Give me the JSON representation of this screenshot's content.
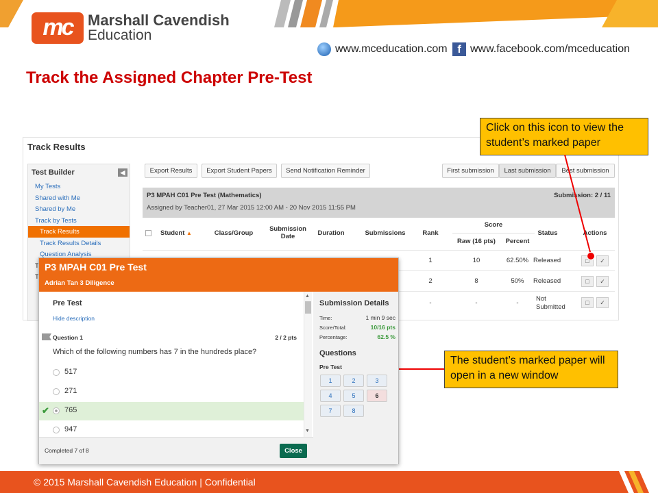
{
  "brand": {
    "logo_mark": "mc",
    "name_line1": "Marshall Cavendish",
    "name_line2": "Education",
    "website": "www.mceducation.com",
    "facebook": "www.facebook.com/mceducation",
    "accent": "#e8531e"
  },
  "slide_title": "Track the Assigned Chapter Pre-Test",
  "track_results": {
    "title": "Track Results",
    "sidebar": {
      "heading": "Test Builder",
      "items": [
        {
          "label": "My Tests"
        },
        {
          "label": "Shared with Me"
        },
        {
          "label": "Shared by Me"
        },
        {
          "label": "Track by Tests"
        },
        {
          "label": "Track Results",
          "active": true
        },
        {
          "label": "Track Results Details"
        },
        {
          "label": "Question Analysis"
        },
        {
          "label": "T"
        },
        {
          "label": "T"
        }
      ]
    },
    "toolbar": {
      "export_results": "Export Results",
      "export_papers": "Export Student Papers",
      "send_reminder": "Send Notification Reminder",
      "first_submission": "First submission",
      "last_submission": "Last submission",
      "best_submission": "Best submission"
    },
    "test_info": {
      "title": "P3 MPAH C01 Pre Test (Mathematics)",
      "assigned": "Assigned by Teacher01, 27 Mar 2015 12:00 AM - 20 Nov 2015 11:55 PM",
      "submission_label": "Submission: 2 / 11"
    },
    "columns": {
      "student": "Student",
      "class_group": "Class/Group",
      "submission_date": "Submission Date",
      "duration": "Duration",
      "submissions": "Submissions",
      "rank": "Rank",
      "score": "Score",
      "raw": "Raw (16 pts)",
      "percent": "Percent",
      "status": "Status",
      "actions": "Actions"
    },
    "rows": [
      {
        "rank": "1",
        "raw": "10",
        "percent": "62.50%",
        "status": "Released"
      },
      {
        "rank": "2",
        "raw": "8",
        "percent": "50%",
        "status": "Released"
      },
      {
        "rank": "-",
        "raw": "-",
        "percent": "-",
        "status": "Not Submitted"
      }
    ]
  },
  "callouts": {
    "icon_hint": "Click on this icon to view the student’s marked paper",
    "window_hint": "The student’s marked paper will open in a new window"
  },
  "popup": {
    "title": "P3 MPAH C01 Pre Test",
    "student": "Adrian Tan 3 Diligence",
    "section": "Pre Test",
    "hide_description": "Hide description",
    "question_label": "Question 1",
    "question_points": "2 / 2 pts",
    "question_text": "Which of the following numbers has 7 in the hundreds place?",
    "options": [
      {
        "label": "517",
        "correct": false
      },
      {
        "label": "271",
        "correct": false
      },
      {
        "label": "765",
        "correct": true
      },
      {
        "label": "947",
        "correct": false
      }
    ],
    "completed": "Completed 7 of 8",
    "close": "Close",
    "details": {
      "heading": "Submission Details",
      "time_label": "Time:",
      "time_value": "1 min 9 sec",
      "score_label": "Score/Total:",
      "score_value": "10/16 pts",
      "pct_label": "Percentage:",
      "pct_value": "62.5 %",
      "questions_heading": "Questions",
      "questions_section": "Pre Test",
      "question_numbers": [
        "1",
        "2",
        "3",
        "4",
        "5",
        "6",
        "7",
        "8"
      ]
    }
  },
  "footer": "© 2015 Marshall Cavendish Education | Confidential"
}
